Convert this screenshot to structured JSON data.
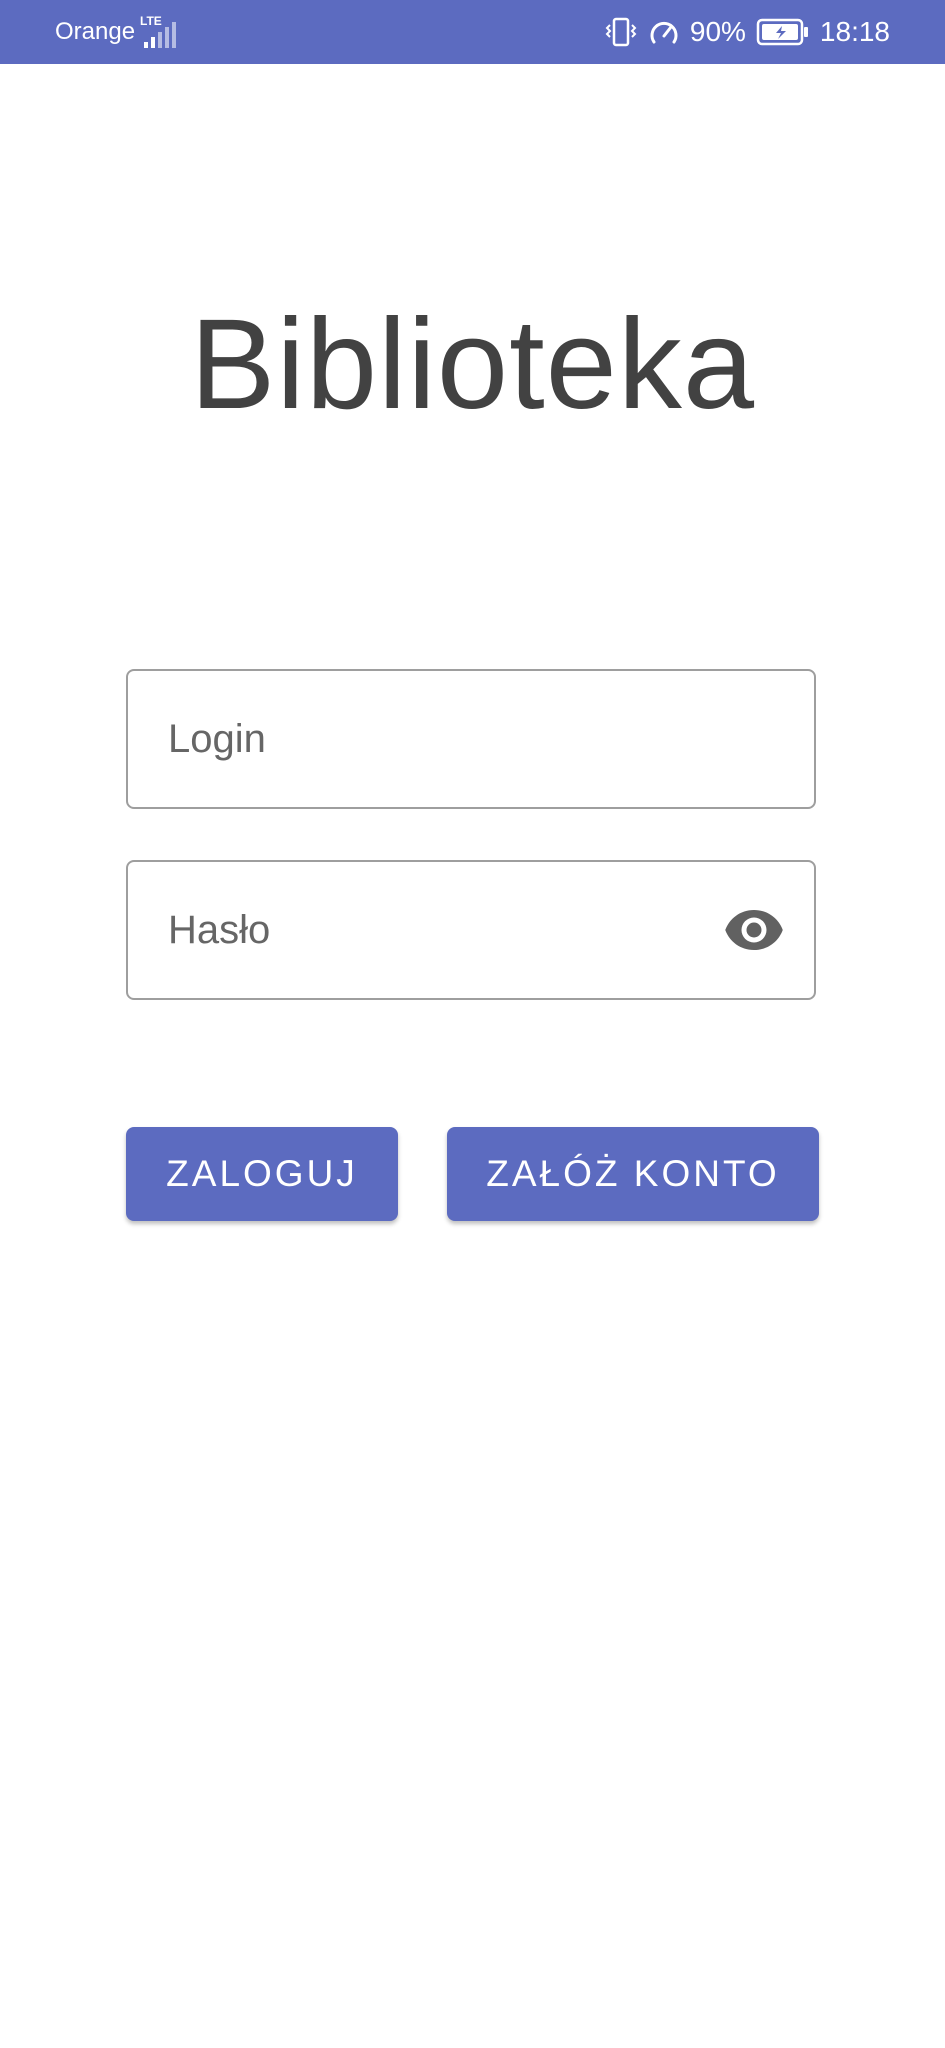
{
  "status_bar": {
    "carrier": "Orange",
    "network_type": "LTE",
    "battery_percent": "90%",
    "time": "18:18",
    "background_color": "#5c6bc0",
    "icons": [
      "signal-icon",
      "vibrate-icon",
      "speed-icon",
      "battery-charging-icon"
    ]
  },
  "app": {
    "title": "Biblioteka"
  },
  "form": {
    "login": {
      "placeholder": "Login",
      "value": ""
    },
    "password": {
      "placeholder": "Hasło",
      "value": "",
      "toggle_icon": "eye-icon"
    }
  },
  "buttons": {
    "login_label": "ZALOGUJ",
    "register_label": "ZAŁÓŻ KONTO",
    "accent_color": "#5c6bc0"
  }
}
